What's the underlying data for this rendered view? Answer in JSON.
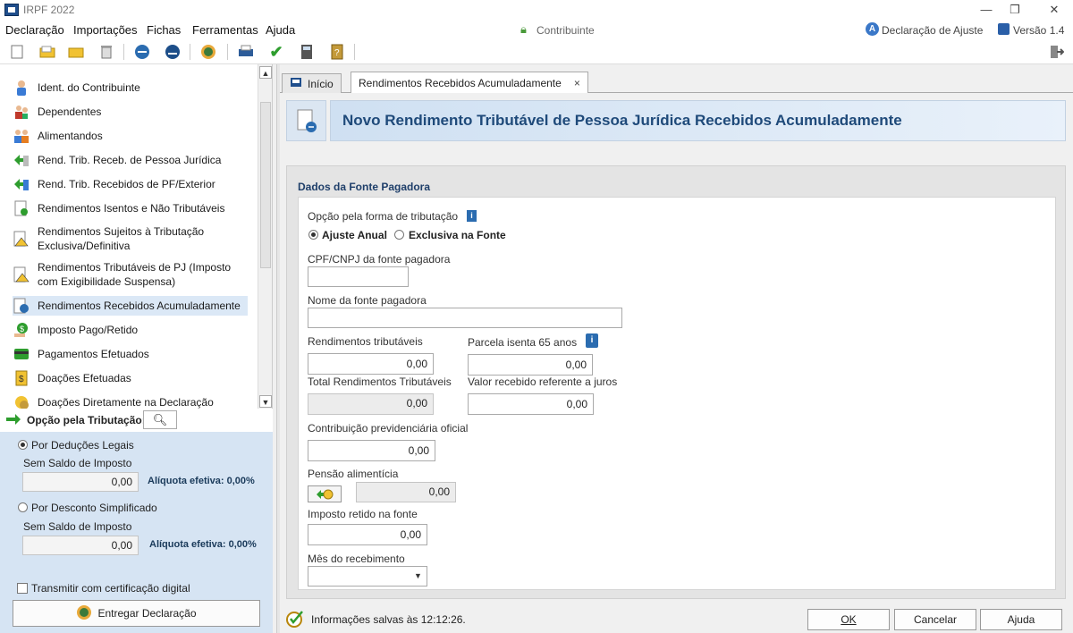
{
  "window": {
    "title": "IRPF 2022",
    "minimize": "—",
    "restore": "❐",
    "close": "✕"
  },
  "menu": {
    "declaracao": "Declaração",
    "importacoes": "Importações",
    "fichas": "Fichas",
    "ferramentas": "Ferramentas",
    "ajuda": "Ajuda",
    "contribuinte": "Contribuinte",
    "declaracao_ajuste": "Declaração de Ajuste",
    "versao": "Versão 1.4"
  },
  "sidebar": {
    "items": [
      {
        "label": "Ident. do Contribuinte"
      },
      {
        "label": "Dependentes"
      },
      {
        "label": "Alimentandos"
      },
      {
        "label": "Rend. Trib. Receb. de Pessoa Jurídica"
      },
      {
        "label": "Rend. Trib. Recebidos de PF/Exterior"
      },
      {
        "label": "Rendimentos Isentos e Não Tributáveis"
      },
      {
        "label": "Rendimentos Sujeitos à Tributação",
        "label2": "Exclusiva/Definitiva"
      },
      {
        "label": "Rendimentos Tributáveis de PJ (Imposto",
        "label2": "com Exigibilidade Suspensa)"
      },
      {
        "label": "Rendimentos Recebidos Acumuladamente"
      },
      {
        "label": "Imposto Pago/Retido"
      },
      {
        "label": "Pagamentos Efetuados"
      },
      {
        "label": "Doações Efetuadas"
      },
      {
        "label": "Doações Diretamente na Declaração"
      }
    ]
  },
  "tributacao": {
    "header": "Opção pela Tributação:",
    "deducoes_label": "Por Deduções Legais",
    "deducoes_sub": "Sem Saldo de Imposto",
    "deducoes_value": "0,00",
    "deducoes_aliquota": "Alíquota efetiva: 0,00%",
    "simplificado_label": "Por Desconto Simplificado",
    "simplificado_sub": "Sem Saldo de Imposto",
    "simplificado_value": "0,00",
    "simplificado_aliquota": "Alíquota efetiva: 0,00%",
    "cert_label": "Transmitir com certificação digital",
    "entregar_label": "Entregar Declaração"
  },
  "tabs": {
    "inicio": "Início",
    "active": "Rendimentos Recebidos Acumuladamente",
    "close": "×"
  },
  "form": {
    "title": "Novo Rendimento Tributável de Pessoa Jurídica Recebidos Acumuladamente",
    "section": "Dados da Fonte Pagadora",
    "opcao_label": "Opção pela forma de tributação",
    "ajuste_anual": "Ajuste Anual",
    "exclusiva": "Exclusiva na Fonte",
    "cpf_label": "CPF/CNPJ da fonte pagadora",
    "cpf_value": "",
    "nome_label": "Nome da fonte pagadora",
    "nome_value": "",
    "rend_trib_label": "Rendimentos tributáveis",
    "rend_trib_value": "0,00",
    "parcela_label": "Parcela isenta 65 anos",
    "parcela_value": "0,00",
    "total_label": "Total Rendimentos Tributáveis",
    "total_value": "0,00",
    "juros_label": "Valor recebido referente a juros",
    "juros_value": "0,00",
    "contrib_label": "Contribuição previdenciária oficial",
    "contrib_value": "0,00",
    "pensao_label": "Pensão alimentícia",
    "pensao_value": "0,00",
    "imposto_label": "Imposto retido na fonte",
    "imposto_value": "0,00",
    "mes_label": "Mês do recebimento",
    "mes_value": ""
  },
  "footer": {
    "status": "Informações salvas às 12:12:26.",
    "ok": "OK",
    "cancelar": "Cancelar",
    "ajuda": "Ajuda"
  }
}
